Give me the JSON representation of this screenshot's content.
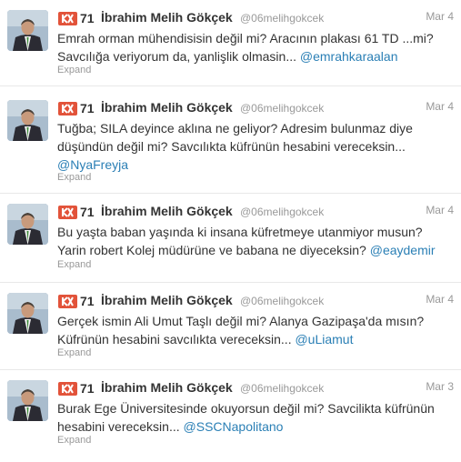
{
  "tweets": [
    {
      "klout_score": "71",
      "author_name": "İbrahim Melih Gökçek",
      "handle": "@06melihgokcek",
      "date": "Mar 4",
      "text_lines": [
        "Emrah orman mühendisisin değil mi? Aracının plakası 61 TD ...mi?",
        "Savcılığa veriyorum da, yanlişlik olmasin..."
      ],
      "mention": "@emrahkaraalan",
      "expand_label": "Expand"
    },
    {
      "klout_score": "71",
      "author_name": "İbrahim Melih Gökçek",
      "handle": "@06melihgokcek",
      "date": "Mar 4",
      "text_lines": [
        "Tuğba; SILA deyince aklına ne geliyor? Adresim bulunmaz diye",
        "düşündün değil mi? Savcılıkta küfrünün hesabini vereceksin..."
      ],
      "mention": "@NyaFreyja",
      "expand_label": "Expand"
    },
    {
      "klout_score": "71",
      "author_name": "İbrahim Melih Gökçek",
      "handle": "@06melihgokcek",
      "date": "Mar 4",
      "text_lines": [
        "Bu yaşta baban yaşında ki insana küfretmeye utanmiyor musun?",
        "Yarin robert Kolej müdürüne ve babana ne diyeceksin?"
      ],
      "mention": "@eaydemir",
      "expand_label": "Expand"
    },
    {
      "klout_score": "71",
      "author_name": "İbrahim Melih Gökçek",
      "handle": "@06melihgokcek",
      "date": "Mar 4",
      "text_lines": [
        "Gerçek ismin Ali Umut Taşlı değil mi? Alanya Gazipaşa'da mısın?",
        "Küfrünün hesabini savcılıkta vereceksin..."
      ],
      "mention": "@uLiamut",
      "expand_label": "Expand"
    },
    {
      "klout_score": "71",
      "author_name": "İbrahim Melih Gökçek",
      "handle": "@06melihgokcek",
      "date": "Mar 3",
      "text_lines": [
        "Burak Ege Üniversitesinde okuyorsun değil mi? Savcilikta küfrünün",
        "hesabini vereceksin..."
      ],
      "mention": "@SSCNapolitano",
      "expand_label": "Expand"
    }
  ],
  "colors": {
    "klout": "#e2533a",
    "mention": "#2a7fb5",
    "muted": "#999999",
    "text": "#333333"
  }
}
